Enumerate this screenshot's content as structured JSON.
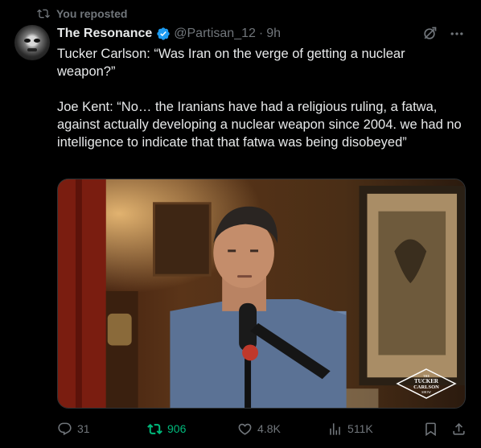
{
  "social_context": {
    "label": "You reposted",
    "icon": "repost-icon"
  },
  "author": {
    "name": "The Resonance",
    "handle": "@Partisan_12",
    "separator": "·",
    "time": "9h",
    "verified_color": "#1d9bf0"
  },
  "post": {
    "paragraphs": [
      "Tucker Carlson: “Was Iran on the verge of getting a nuclear weapon?”",
      "Joe Kent: “No… the Iranians have had a religious ruling, a fatwa, against actually developing a nuclear weapon since 2004. we had no intelligence to indicate that that fatwa was being disobeyed”"
    ]
  },
  "media": {
    "mic_badge": "TCN",
    "watermark": {
      "line1": "THE",
      "line2": "TUCKER",
      "line3": "CARLSON",
      "line4": "SHOW"
    }
  },
  "metrics": {
    "replies": "31",
    "reposts": "906",
    "likes": "4.8K",
    "views": "511K",
    "repost_active_color": "#00ba7c"
  }
}
